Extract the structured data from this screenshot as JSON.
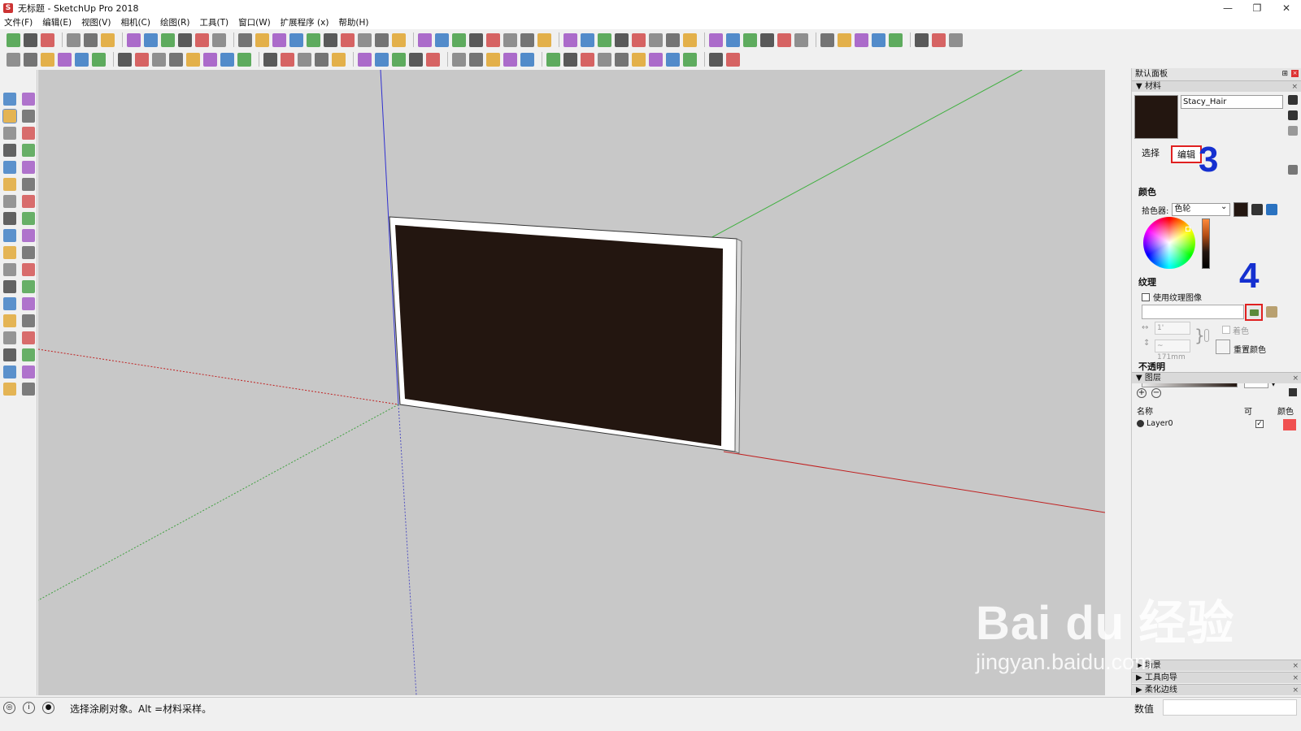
{
  "window": {
    "title": "无标题 - SketchUp Pro 2018",
    "controls": [
      "—",
      "❐",
      "✕"
    ]
  },
  "menu": [
    "文件(F)",
    "编辑(E)",
    "视图(V)",
    "相机(C)",
    "绘图(R)",
    "工具(T)",
    "窗口(W)",
    "扩展程序 (x)",
    "帮助(H)"
  ],
  "tray": {
    "title": "默认面板",
    "materials": {
      "header": "材料",
      "name": "Stacy_Hair",
      "swatch_color": "#231610",
      "tab_select": "选择",
      "tab_edit": "编辑",
      "annotation_3": "3",
      "annotation_4": "4",
      "color_section": "颜色",
      "picker_label": "拾色器:",
      "picker_value": "色轮",
      "texture_section": "纹理",
      "use_texture": "使用纹理图像",
      "texture_path": "",
      "width_value": "1'",
      "height_value": "~ 171mm",
      "colorize": "着色",
      "reset_color": "重置颜色",
      "opacity_section": "不透明",
      "opacity_value": "100"
    },
    "layers": {
      "header": "图层",
      "col_name": "名称",
      "col_visible": "可",
      "col_color": "颜色",
      "rows": [
        {
          "name": "Layer0",
          "visible": true,
          "color": "#f05050"
        }
      ]
    },
    "collapsed": [
      "场景",
      "工具向导",
      "柔化边线"
    ]
  },
  "status": {
    "text": "选择涂刷对象。Alt =材料采样。",
    "measure_label": "数值",
    "measure_value": ""
  },
  "watermark": {
    "main": "Bai du 经验",
    "sub": "jingyan.baidu.com"
  },
  "colors": {
    "accent_red": "#e02020",
    "annotation_blue": "#1530d0",
    "viewport_bg": "#c8c8c8",
    "board": "#231610"
  }
}
